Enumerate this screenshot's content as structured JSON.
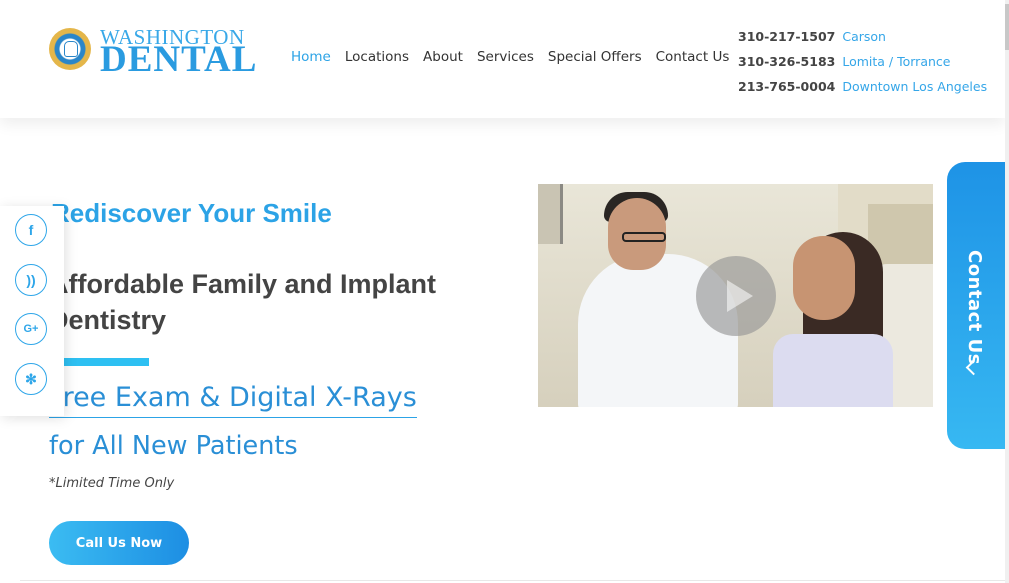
{
  "header": {
    "logo": {
      "top": "WASHINGTON",
      "bottom": "DENTAL"
    },
    "nav": [
      {
        "label": "Home",
        "active": true
      },
      {
        "label": "Locations",
        "active": false
      },
      {
        "label": "About",
        "active": false
      },
      {
        "label": "Services",
        "active": false
      },
      {
        "label": "Special Offers",
        "active": false
      },
      {
        "label": "Contact Us",
        "active": false
      }
    ],
    "phones": [
      {
        "number": "310-217-1507",
        "location": "Carson"
      },
      {
        "number": "310-326-5183",
        "location": "Lomita / Torrance"
      },
      {
        "number": "213-765-0004",
        "location": "Downtown Los Angeles"
      }
    ]
  },
  "social": [
    {
      "name": "facebook-icon",
      "glyph": "f"
    },
    {
      "name": "rss-icon",
      "glyph": "))"
    },
    {
      "name": "google-plus-icon",
      "glyph": "G+"
    },
    {
      "name": "yelp-icon",
      "glyph": "✻"
    }
  ],
  "hero": {
    "tagline": "Rediscover Your Smile",
    "title": "Affordable Family and Implant Dentistry",
    "offer": "Free Exam & Digital X-Rays",
    "offer_sub": "for All New Patients",
    "note": "*Limited Time Only",
    "cta": "Call Us Now"
  },
  "contact_tab": {
    "label": "Contact Us"
  },
  "colors": {
    "accent": "#2ca3e6",
    "accent_dark": "#1d8ee3",
    "text": "#444444"
  }
}
